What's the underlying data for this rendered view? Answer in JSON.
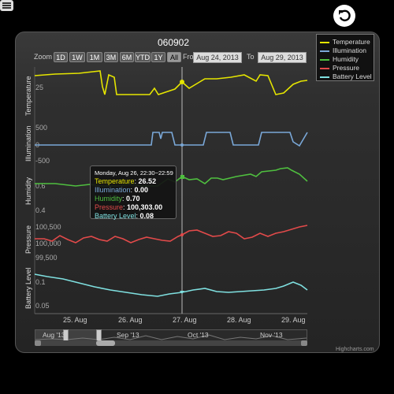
{
  "chart_title": "060902",
  "zoom": {
    "label": "Zoom",
    "buttons": [
      "1D",
      "1W",
      "1M",
      "3M",
      "6M",
      "YTD",
      "1Y",
      "All"
    ],
    "selected": "All"
  },
  "date_range": {
    "from_label": "From",
    "from": "Aug 24, 2013",
    "to_label": "To",
    "to": "Aug 29, 2013"
  },
  "legend": [
    {
      "name": "Temperature",
      "color": "#e5e500"
    },
    {
      "name": "Illumination",
      "color": "#7aa8d8"
    },
    {
      "name": "Humidity",
      "color": "#4fbf3f"
    },
    {
      "name": "Pressure",
      "color": "#e24a4a"
    },
    {
      "name": "Battery Level",
      "color": "#7fe0e0"
    }
  ],
  "axes": {
    "temperature": {
      "title": "Temperature",
      "ticks": [
        "25"
      ]
    },
    "illumination": {
      "title": "Illumination",
      "ticks": [
        "500",
        "0",
        "-500"
      ]
    },
    "humidity": {
      "title": "Humidity",
      "ticks": [
        "0.6",
        "0.4"
      ]
    },
    "pressure": {
      "title": "Pressure",
      "ticks": [
        "100,500",
        "100,000",
        "99,500"
      ]
    },
    "battery": {
      "title": "Battery Level",
      "ticks": [
        "0.1",
        "0.05"
      ]
    }
  },
  "x_ticks": [
    "25. Aug",
    "26. Aug",
    "27. Aug",
    "28. Aug",
    "29. Aug"
  ],
  "tooltip": {
    "header": "Monday, Aug 26, 22:30~22:59",
    "rows": [
      {
        "label": "Temperature",
        "value": "26.52",
        "color": "#e5e500"
      },
      {
        "label": "Illumination",
        "value": "0.00",
        "color": "#7aa8d8"
      },
      {
        "label": "Humidity",
        "value": "0.70",
        "color": "#4fbf3f"
      },
      {
        "label": "Pressure",
        "value": "100,303.00",
        "color": "#e24a4a"
      },
      {
        "label": "Battery Level",
        "value": "0.08",
        "color": "#7fe0e0"
      }
    ]
  },
  "navigator_ticks": [
    "Aug '13",
    "Sep '13",
    "Oct '13",
    "Nov '13"
  ],
  "credits": "Highcharts.com",
  "icons": {
    "back": "undo-arrow-icon",
    "menu": "hamburger-menu-icon"
  }
}
